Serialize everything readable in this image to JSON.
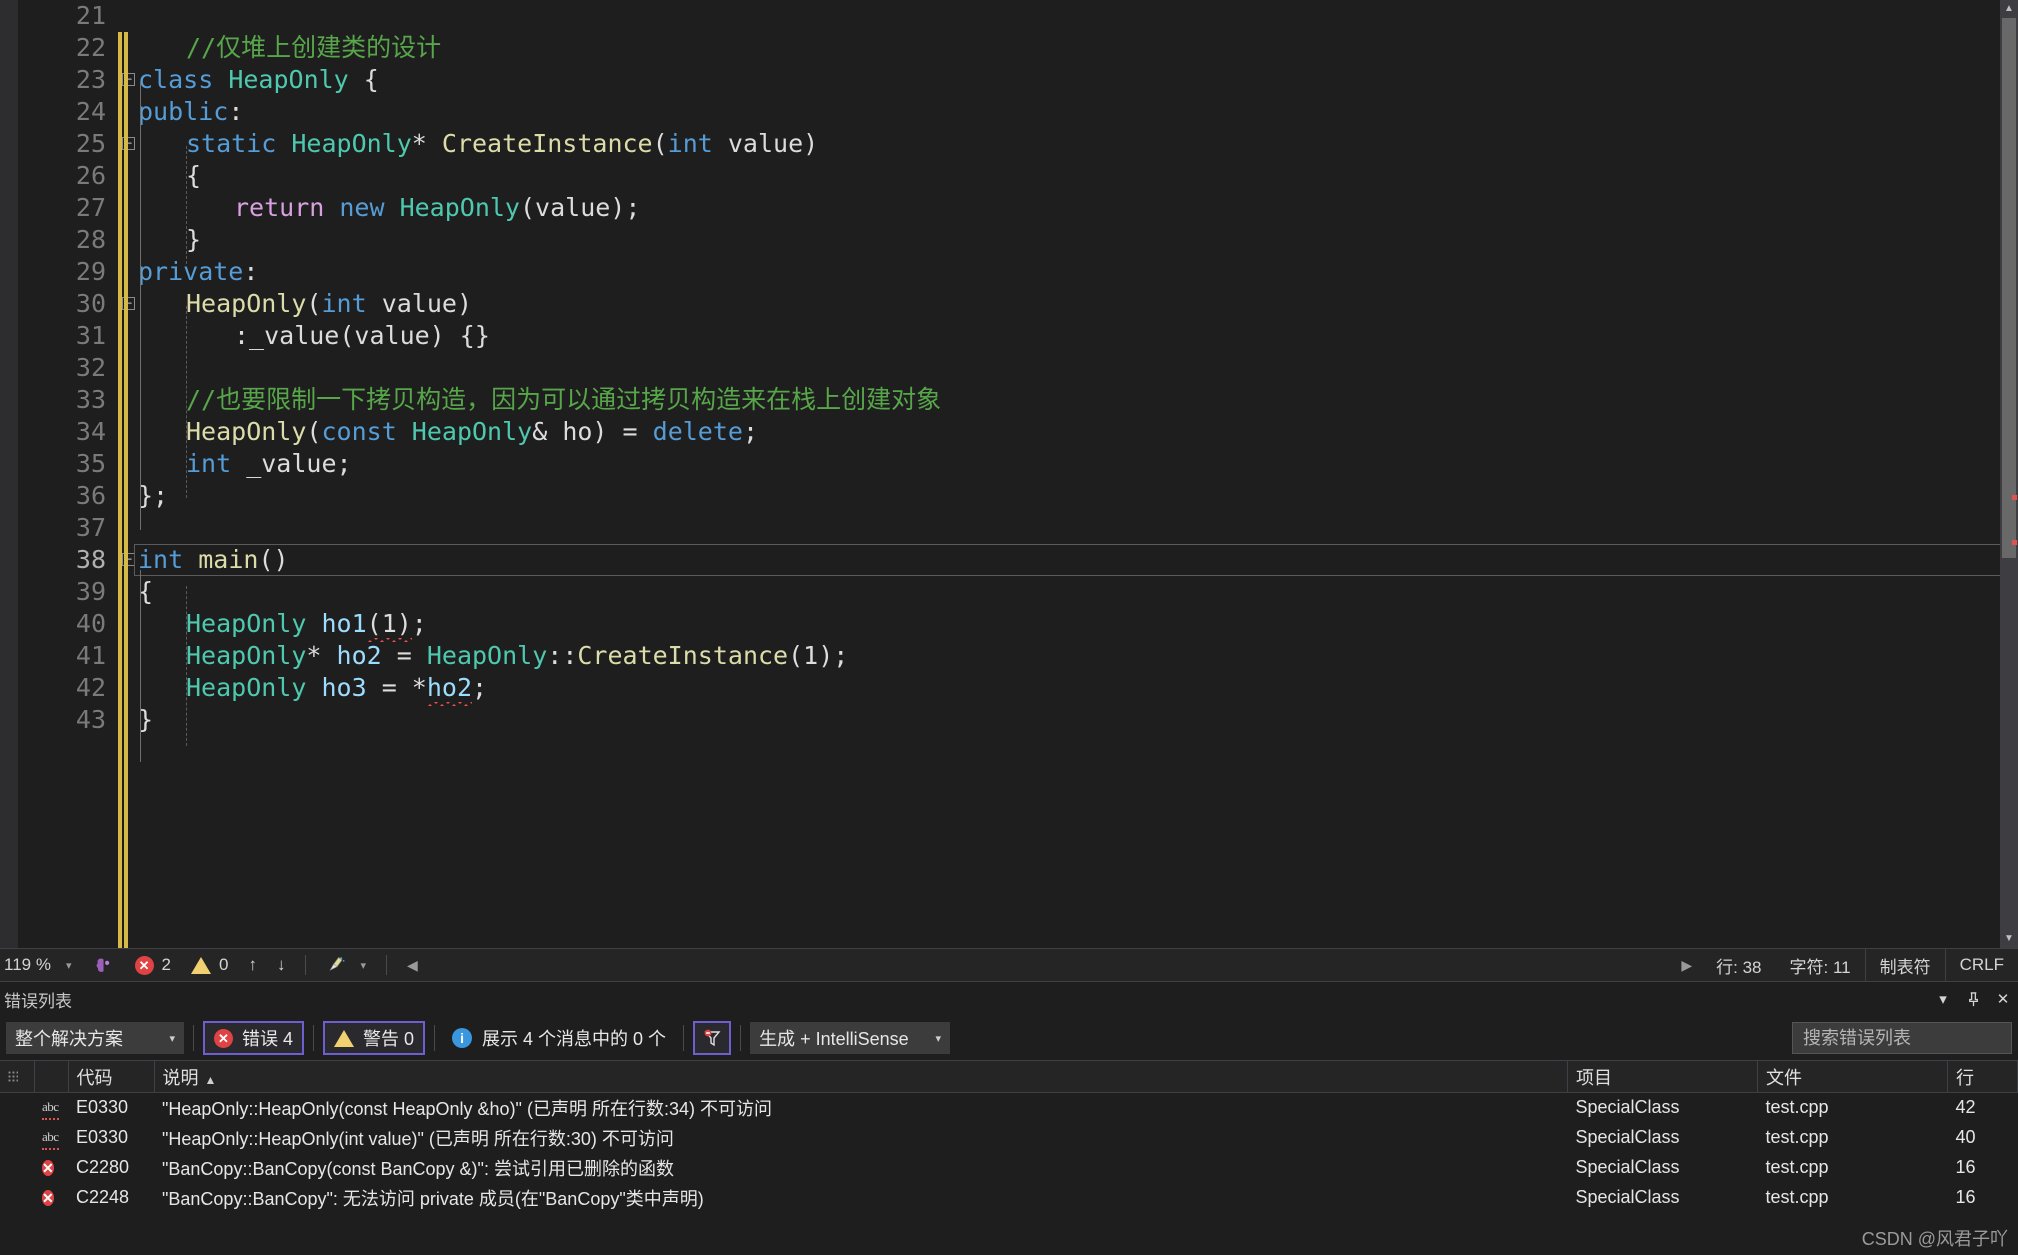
{
  "editor": {
    "first_line": 21,
    "current_line": 38,
    "lines": [
      {
        "n": 21,
        "tokens": []
      },
      {
        "n": 22,
        "indent": 1,
        "tokens": [
          {
            "t": "//仅堆上创建类的设计",
            "c": "cmt"
          }
        ]
      },
      {
        "n": 23,
        "indent": 0,
        "fold": "minus",
        "tokens": [
          {
            "t": "class ",
            "c": "k"
          },
          {
            "t": "HeapOnly",
            "c": "typ"
          },
          {
            "t": " {",
            "c": "pun"
          }
        ]
      },
      {
        "n": 24,
        "indent": 0,
        "tokens": [
          {
            "t": "public",
            "c": "k"
          },
          {
            "t": ":",
            "c": "pun"
          }
        ]
      },
      {
        "n": 25,
        "indent": 1,
        "fold": "minus",
        "tokens": [
          {
            "t": "static ",
            "c": "k"
          },
          {
            "t": "HeapOnly",
            "c": "typ"
          },
          {
            "t": "* ",
            "c": "pun"
          },
          {
            "t": "CreateInstance",
            "c": "fn"
          },
          {
            "t": "(",
            "c": "pun"
          },
          {
            "t": "int",
            "c": "k"
          },
          {
            "t": " value)",
            "c": "pl"
          }
        ]
      },
      {
        "n": 26,
        "indent": 1,
        "tokens": [
          {
            "t": "{",
            "c": "pun"
          }
        ]
      },
      {
        "n": 27,
        "indent": 2,
        "tokens": [
          {
            "t": "return ",
            "c": "ctl"
          },
          {
            "t": "new ",
            "c": "k"
          },
          {
            "t": "HeapOnly",
            "c": "typ"
          },
          {
            "t": "(value);",
            "c": "pl"
          }
        ]
      },
      {
        "n": 28,
        "indent": 1,
        "tokens": [
          {
            "t": "}",
            "c": "pun"
          }
        ]
      },
      {
        "n": 29,
        "indent": 0,
        "tokens": [
          {
            "t": "private",
            "c": "k"
          },
          {
            "t": ":",
            "c": "pun"
          }
        ]
      },
      {
        "n": 30,
        "indent": 1,
        "fold": "minus",
        "tokens": [
          {
            "t": "HeapOnly",
            "c": "fn"
          },
          {
            "t": "(",
            "c": "pun"
          },
          {
            "t": "int",
            "c": "k"
          },
          {
            "t": " value)",
            "c": "pl"
          }
        ]
      },
      {
        "n": 31,
        "indent": 2,
        "tokens": [
          {
            "t": ":_value(value) {}",
            "c": "pl"
          }
        ]
      },
      {
        "n": 32,
        "tokens": []
      },
      {
        "n": 33,
        "indent": 1,
        "tokens": [
          {
            "t": "//也要限制一下拷贝构造，因为可以通过拷贝构造来在栈上创建对象",
            "c": "cmt"
          }
        ]
      },
      {
        "n": 34,
        "indent": 1,
        "tokens": [
          {
            "t": "HeapOnly",
            "c": "fn"
          },
          {
            "t": "(",
            "c": "pun"
          },
          {
            "t": "const ",
            "c": "k"
          },
          {
            "t": "HeapOnly",
            "c": "typ"
          },
          {
            "t": "& ho) = ",
            "c": "pl"
          },
          {
            "t": "delete",
            "c": "k"
          },
          {
            "t": ";",
            "c": "pun"
          }
        ]
      },
      {
        "n": 35,
        "indent": 1,
        "tokens": [
          {
            "t": "int",
            "c": "k"
          },
          {
            "t": " _value;",
            "c": "pl"
          }
        ]
      },
      {
        "n": 36,
        "indent": 0,
        "tokens": [
          {
            "t": "};",
            "c": "pun"
          }
        ]
      },
      {
        "n": 37,
        "tokens": []
      },
      {
        "n": 38,
        "indent": 0,
        "fold": "minus",
        "current": true,
        "tokens": [
          {
            "t": "int",
            "c": "k"
          },
          {
            "t": " ",
            "c": "pl"
          },
          {
            "t": "main",
            "c": "fn"
          },
          {
            "t": "()",
            "c": "pun"
          }
        ]
      },
      {
        "n": 39,
        "indent": 0,
        "tokens": [
          {
            "t": "{",
            "c": "pun"
          }
        ]
      },
      {
        "n": 40,
        "indent": 1,
        "tokens": [
          {
            "t": "HeapOnly",
            "c": "typ"
          },
          {
            "t": " ",
            "c": "pl"
          },
          {
            "t": "ho1",
            "c": "var"
          },
          {
            "t": "(1)",
            "c": "pl",
            "error": true
          },
          {
            "t": ";",
            "c": "pun"
          }
        ]
      },
      {
        "n": 41,
        "indent": 1,
        "tokens": [
          {
            "t": "HeapOnly",
            "c": "typ"
          },
          {
            "t": "* ",
            "c": "pun"
          },
          {
            "t": "ho2",
            "c": "var"
          },
          {
            "t": " = ",
            "c": "pl"
          },
          {
            "t": "HeapOnly",
            "c": "typ"
          },
          {
            "t": "::",
            "c": "pun"
          },
          {
            "t": "CreateInstance",
            "c": "fn"
          },
          {
            "t": "(1);",
            "c": "pl"
          }
        ]
      },
      {
        "n": 42,
        "indent": 1,
        "tokens": [
          {
            "t": "HeapOnly",
            "c": "typ"
          },
          {
            "t": " ",
            "c": "pl"
          },
          {
            "t": "ho3",
            "c": "var"
          },
          {
            "t": " = *",
            "c": "pl"
          },
          {
            "t": "ho2",
            "c": "var",
            "error": true
          },
          {
            "t": ";",
            "c": "pun"
          }
        ]
      },
      {
        "n": 43,
        "indent": 0,
        "tokens": [
          {
            "t": "}",
            "c": "pun"
          }
        ]
      }
    ]
  },
  "statusbar": {
    "zoom": "119 %",
    "zoom_caret": "▾",
    "error_count": "2",
    "warning_count": "0",
    "up_arrow": "↑",
    "down_arrow": "↓",
    "broom_caret": "▾",
    "left_arrow": "◀",
    "right_arrow": "▶",
    "line_label": "行: 38",
    "char_label": "字符: 11",
    "tabs_label": "制表符",
    "eol_label": "CRLF"
  },
  "panel": {
    "title": "错误列表",
    "dropdown_caret": "▾",
    "pin_icon": "⊹",
    "close_icon": "✕",
    "scope": "整个解决方案",
    "scope_caret": "▾",
    "errors_toggle": "错误 4",
    "warnings_toggle": "警告 0",
    "messages_text": "展示 4 个消息中的 0 个",
    "build_filter": "生成 + IntelliSense",
    "build_filter_caret": "▾",
    "search_placeholder": "搜索错误列表",
    "search_value": "",
    "columns": [
      "",
      "代码",
      "说明",
      "项目",
      "文件",
      "行"
    ],
    "sort_column": "说明",
    "sort_caret": "▲",
    "rows": [
      {
        "severity": "intellisense",
        "sev_glyph": "abc",
        "code": "E0330",
        "description": "\"HeapOnly::HeapOnly(const HeapOnly &ho)\" (已声明 所在行数:34) 不可访问",
        "project": "SpecialClass",
        "file": "test.cpp",
        "line": "42"
      },
      {
        "severity": "intellisense",
        "sev_glyph": "abc",
        "code": "E0330",
        "description": "\"HeapOnly::HeapOnly(int value)\" (已声明 所在行数:30) 不可访问",
        "project": "SpecialClass",
        "file": "test.cpp",
        "line": "40"
      },
      {
        "severity": "error",
        "sev_glyph": "✕",
        "code": "C2280",
        "description": "\"BanCopy::BanCopy(const BanCopy &)\": 尝试引用已删除的函数",
        "project": "SpecialClass",
        "file": "test.cpp",
        "line": "16"
      },
      {
        "severity": "error",
        "sev_glyph": "✕",
        "code": "C2248",
        "description": "\"BanCopy::BanCopy\": 无法访问 private 成员(在\"BanCopy\"类中声明)",
        "project": "SpecialClass",
        "file": "test.cpp",
        "line": "16"
      }
    ]
  },
  "watermark": "CSDN @风君子吖",
  "colors": {
    "editor_bg": "#1e1e1e",
    "comment": "#57a64a",
    "keyword": "#569cd6",
    "type": "#4ec9b0",
    "function": "#dcdcaa",
    "error_red": "#e04343",
    "warning_yellow": "#f0d070",
    "accent_purple": "#6d5fd0",
    "link_blue": "#4aa3df"
  }
}
